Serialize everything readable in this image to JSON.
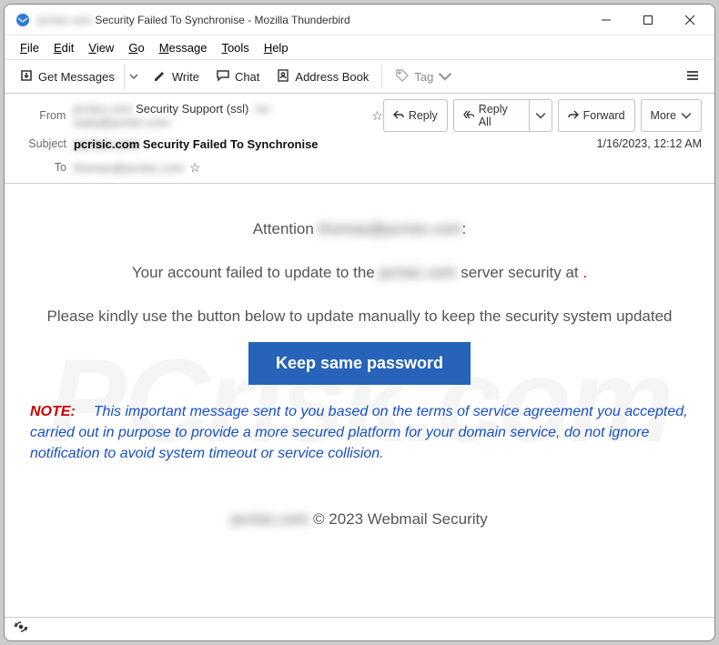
{
  "window": {
    "title_prefix": "pcrisic.com",
    "title": "Security Failed To Synchronise - Mozilla Thunderbird"
  },
  "menu": {
    "file": "File",
    "edit": "Edit",
    "view": "View",
    "go": "Go",
    "message": "Message",
    "tools": "Tools",
    "help": "Help"
  },
  "toolbar": {
    "get_messages": "Get Messages",
    "write": "Write",
    "chat": "Chat",
    "address_book": "Address Book",
    "tag": "Tag"
  },
  "actions": {
    "reply": "Reply",
    "reply_all": "Reply All",
    "forward": "Forward",
    "more": "More"
  },
  "header": {
    "from_label": "From",
    "from_domain": "pcrisic.com",
    "from_name": "Security Support (ssl)",
    "from_email": "no-reply@pcrisic.com",
    "subject_label": "Subject",
    "subject_prefix": "pcrisic.com",
    "subject": "Security Failed To Synchronise",
    "to_label": "To",
    "to_value": "thomas@pcrisic.com",
    "timestamp": "1/16/2023, 12:12 AM"
  },
  "mail": {
    "attention_pre": "Attention ",
    "attention_email": "thomas@pcrisic.com",
    "attention_post": ":",
    "l2_pre": "Your account failed to update to the ",
    "l2_blur": "pcrisic.com",
    "l2_post": " server security at ",
    "l2_dot": ".",
    "l3": "Please kindly use the button below to update manually to keep the security system updated",
    "button": "Keep same password",
    "note_label": "NOTE:",
    "note_body": "This important message sent to you based on the terms of service agreement you accepted, carried out in  purpose to provide a more secured platform for your domain service, do not ignore notification to avoid system timeout or service collision.",
    "footer_blur": "pcrisic.com",
    "footer_rest": " © 2023 Webmail Security"
  }
}
